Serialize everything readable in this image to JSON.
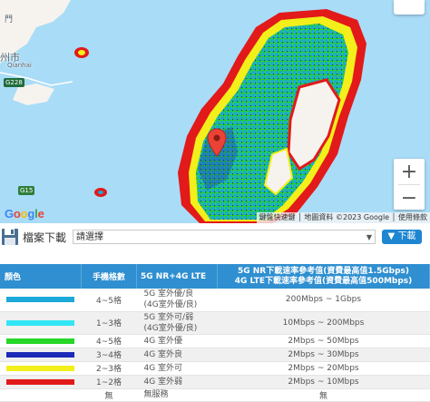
{
  "map": {
    "place_labels": [
      "門",
      "州市",
      "Qianhai"
    ],
    "road_shields": [
      "G228",
      "G15"
    ],
    "zoom_in": "+",
    "zoom_out": "−",
    "google_logo": [
      "G",
      "o",
      "o",
      "g",
      "l",
      "e"
    ],
    "google_colors": [
      "#4285f4",
      "#ea4335",
      "#fbbc05",
      "#4285f4",
      "#34a853",
      "#ea4335"
    ],
    "attribution": "鍵盤快速鍵 │ 地圖資料 ©2023 Google │ 使用條款",
    "coverage_colors": {
      "5g_strong": "#1aa9d8",
      "5g_weak": "#33e6f5",
      "4g_excellent": "#27d627",
      "4g_good": "#1c2ab8",
      "4g_fair": "#f2ef1a",
      "4g_weak": "#e21a1a",
      "sea": "#a9dcf7",
      "land": "#f6f3ee"
    }
  },
  "download": {
    "title": "檔案下載",
    "select_value": "請選擇",
    "button": "下載"
  },
  "legend": {
    "headers": {
      "color": "顏色",
      "bars": "手機格數",
      "network": "5G NR+4G LTE",
      "speed_line1": "5G NR下載速率參考值(資費最高值1.5Gbps)",
      "speed_line2": "4G LTE下載速率參考值(資費最高值500Mbps)"
    },
    "rows": [
      {
        "color": "#1aa9d8",
        "bars": "4~5格",
        "network": [
          "5G 室外優/良",
          "(4G室外優/良)"
        ],
        "speed": "200Mbps ~ 1Gbps"
      },
      {
        "color": "#33e6f5",
        "bars": "1~3格",
        "network": [
          "5G 室外可/弱",
          "(4G室外優/良)"
        ],
        "speed": "10Mbps ~ 200Mbps"
      },
      {
        "color": "#27d627",
        "bars": "4~5格",
        "network": [
          "4G 室外優"
        ],
        "speed": "2Mbps ~ 50Mbps"
      },
      {
        "color": "#1c2ab8",
        "bars": "3~4格",
        "network": [
          "4G 室外良"
        ],
        "speed": "2Mbps ~ 30Mbps"
      },
      {
        "color": "#f2ef1a",
        "bars": "2~3格",
        "network": [
          "4G 室外可"
        ],
        "speed": "2Mbps ~ 20Mbps"
      },
      {
        "color": "#e21a1a",
        "bars": "1~2格",
        "network": [
          "4G 室外弱"
        ],
        "speed": "2Mbps ~ 10Mbps"
      },
      {
        "color": "",
        "bars": "無",
        "network": [
          "無服務"
        ],
        "speed": "無"
      }
    ]
  }
}
